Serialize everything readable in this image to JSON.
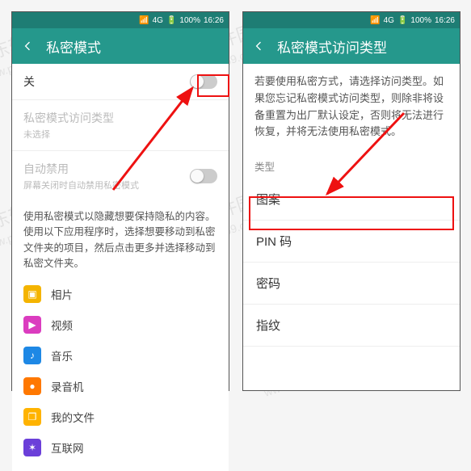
{
  "statusbar": {
    "battery": "100%",
    "time": "16:26",
    "signal": "4G"
  },
  "left": {
    "title": "私密模式",
    "toggle_label": "关",
    "access_type": {
      "title": "私密模式访问类型",
      "sub": "未选择"
    },
    "auto_disable": {
      "title": "自动禁用",
      "sub": "屏幕关闭时自动禁用私密模式"
    },
    "desc_text": "使用私密模式以隐藏想要保持隐私的内容。使用以下应用程序时，选择想要移动到私密文件夹的项目，然后点击更多并选择移动到私密文件夹。",
    "apps": [
      {
        "label": "相片",
        "color": "#f4b400",
        "glyph": "▣"
      },
      {
        "label": "视频",
        "color": "#db3cbf",
        "glyph": "▶"
      },
      {
        "label": "音乐",
        "color": "#1e88e5",
        "glyph": "♪"
      },
      {
        "label": "录音机",
        "color": "#ff7800",
        "glyph": "●"
      },
      {
        "label": "我的文件",
        "color": "#ffb300",
        "glyph": "❐"
      },
      {
        "label": "互联网",
        "color": "#6b3fd9",
        "glyph": "✶"
      }
    ]
  },
  "right": {
    "title": "私密模式访问类型",
    "info": "若要使用私密方式，请选择访问类型。如果您忘记私密模式访问类型，则除非将设备重置为出厂默认设定，否则将无法进行恢复，并将无法使用私密模式。",
    "section_label": "类型",
    "options": [
      "图案",
      "PIN 码",
      "密码",
      "指纹"
    ]
  },
  "watermark": {
    "main": "河东软件园",
    "sub": "www.pc0359.cn"
  }
}
